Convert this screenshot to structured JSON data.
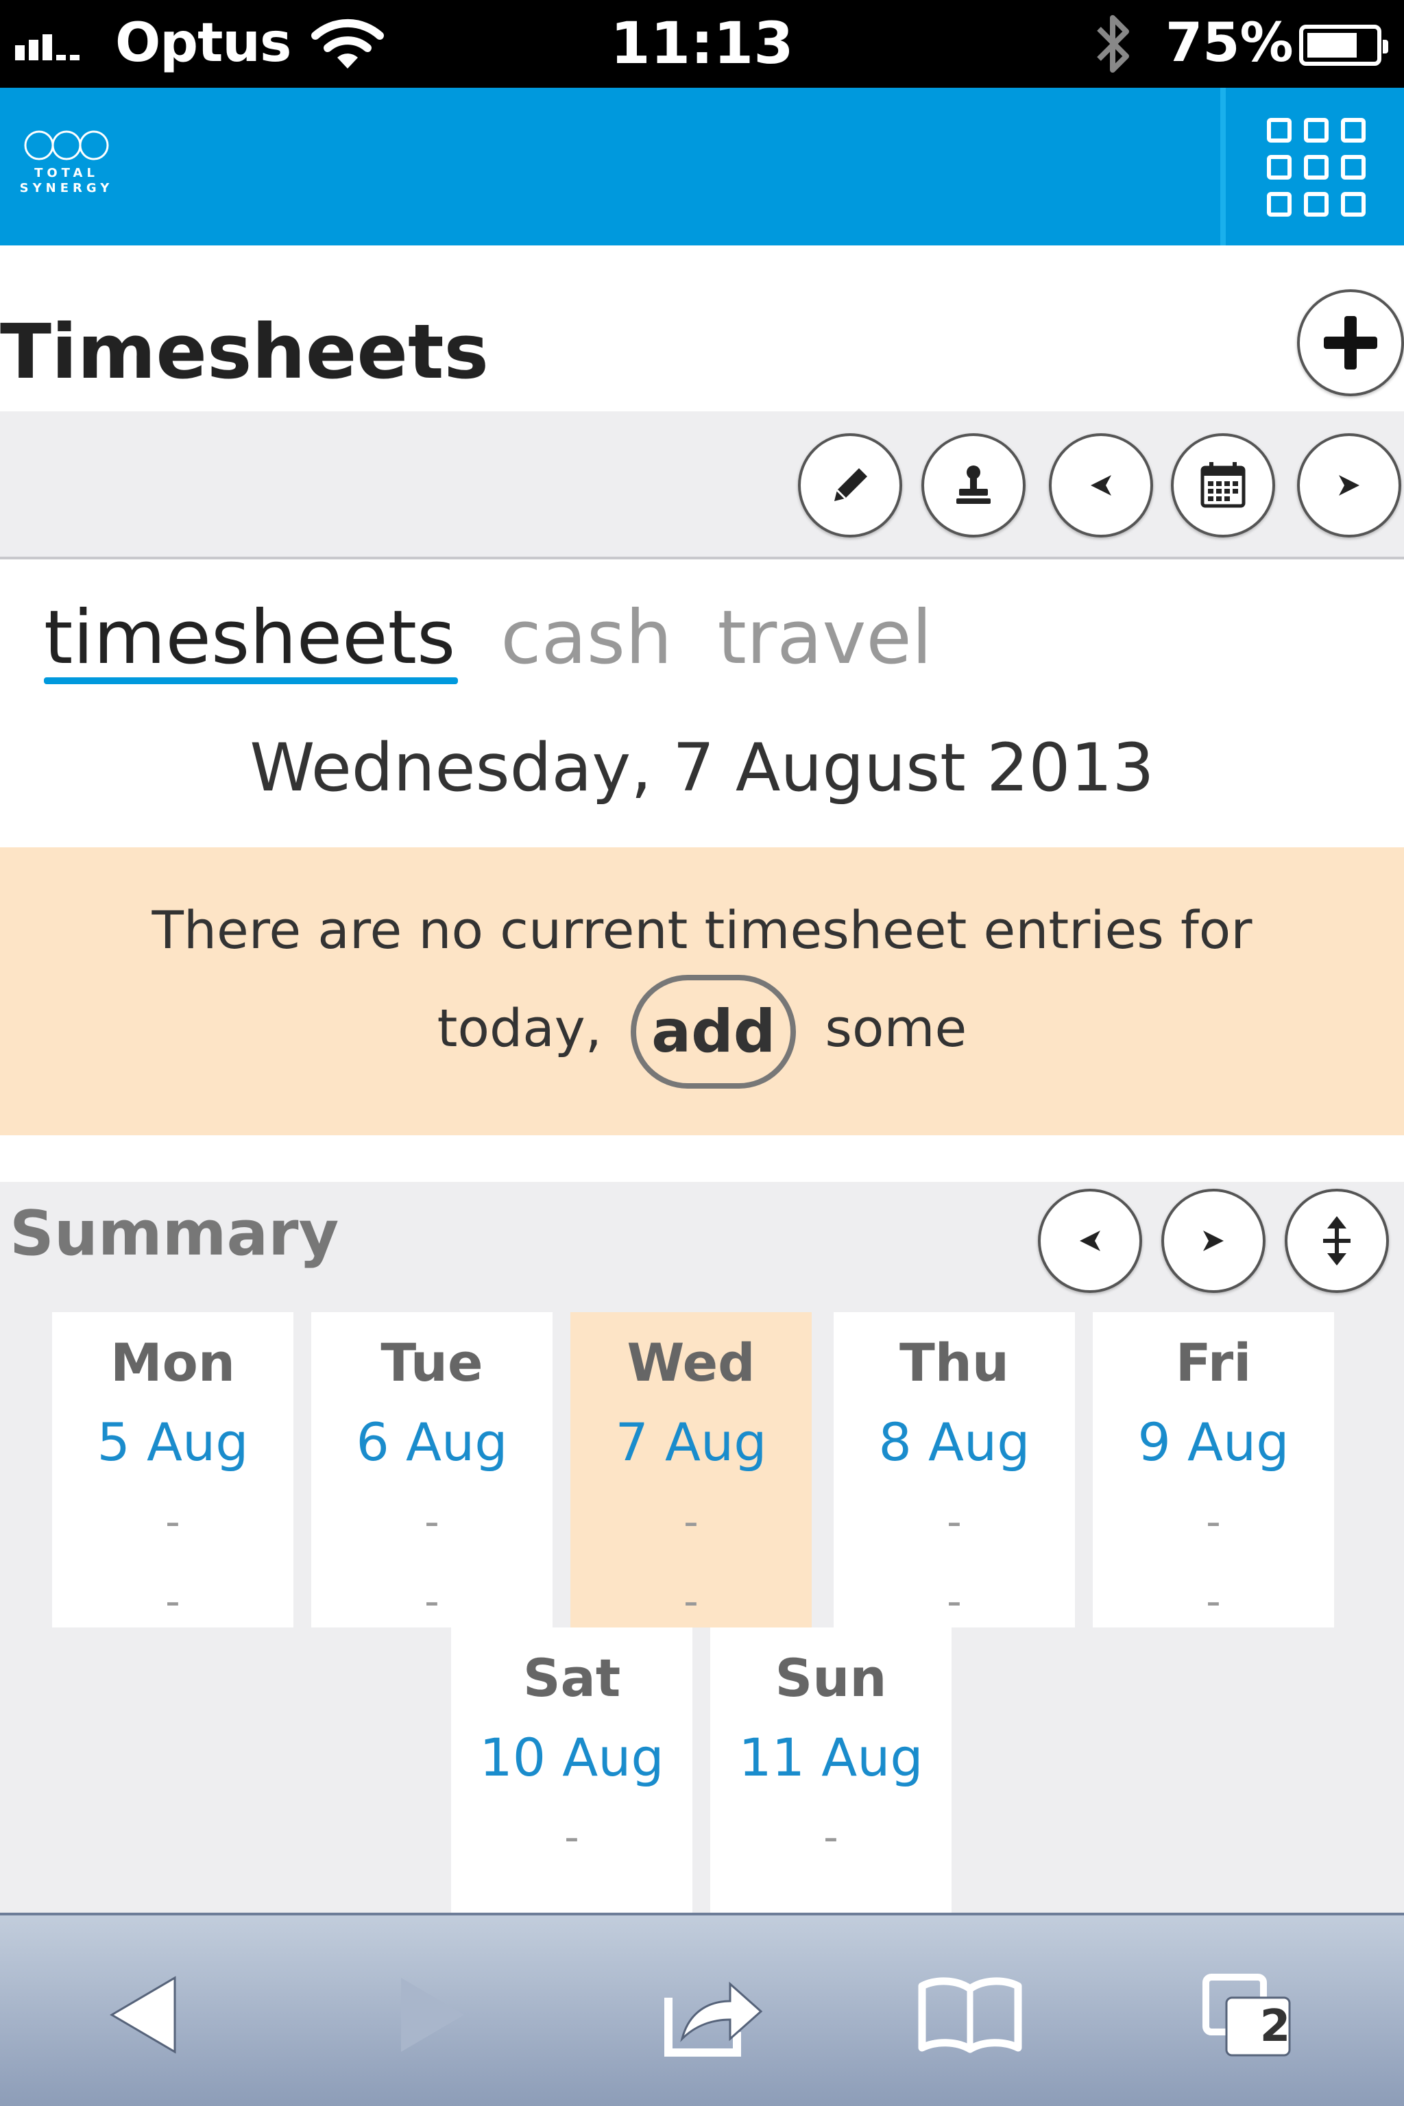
{
  "status_bar": {
    "carrier": "Optus",
    "time": "11:13",
    "battery_percent": "75%",
    "battery_level": 0.75
  },
  "app": {
    "logo_text": "TOTAL SYNERGY",
    "brand_color": "#0099dd"
  },
  "page": {
    "title": "Timesheets"
  },
  "toolbar": {
    "buttons": [
      "pencil-icon",
      "stamp-icon",
      "previous-icon",
      "calendar-icon",
      "next-icon"
    ]
  },
  "tabs": [
    {
      "label": "timesheets",
      "active": true
    },
    {
      "label": "cash",
      "active": false
    },
    {
      "label": "travel",
      "active": false
    }
  ],
  "date_heading": "Wednesday, 7 August 2013",
  "notice": {
    "line1": "There are no current timesheet entries for",
    "line2_prefix": "today,",
    "add_link": "add",
    "line2_suffix": "some",
    "background": "#fde4c6"
  },
  "summary": {
    "title": "Summary",
    "days": [
      {
        "name": "Mon",
        "date": "5 Aug",
        "val1": "-",
        "val2": "-",
        "selected": false
      },
      {
        "name": "Tue",
        "date": "6 Aug",
        "val1": "-",
        "val2": "-",
        "selected": false
      },
      {
        "name": "Wed",
        "date": "7 Aug",
        "val1": "-",
        "val2": "-",
        "selected": true
      },
      {
        "name": "Thu",
        "date": "8 Aug",
        "val1": "-",
        "val2": "-",
        "selected": false
      },
      {
        "name": "Fri",
        "date": "9 Aug",
        "val1": "-",
        "val2": "-",
        "selected": false
      },
      {
        "name": "Sat",
        "date": "10 Aug",
        "val1": "-",
        "val2": "-",
        "selected": false
      },
      {
        "name": "Sun",
        "date": "11 Aug",
        "val1": "-",
        "val2": "-",
        "selected": false
      }
    ]
  },
  "browser_bar": {
    "tab_count": "2"
  }
}
